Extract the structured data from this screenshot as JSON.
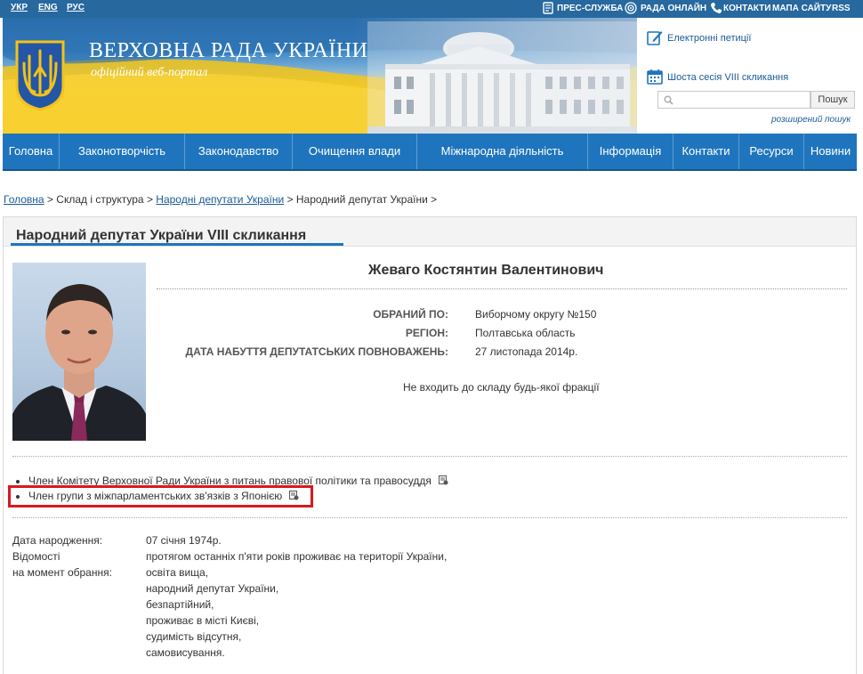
{
  "languages": [
    "УКР",
    "ENG",
    "РУС"
  ],
  "top_links": {
    "press": "ПРЕС-СЛУЖБА",
    "online": "РАДА ОНЛАЙН",
    "contacts": "КОНТАКТИ",
    "sitemap": "МАПА САЙТУ",
    "rss": "RSS"
  },
  "header": {
    "title": "ВЕРХОВНА РАДА УКРАЇНИ",
    "subtitle": "офіційний веб-портал",
    "petitions_link": "Електронні петиції",
    "session_link": "Шоста сесія VIII скликання",
    "search_button": "Пошук",
    "search_placeholder": "",
    "advanced_search": "розширений пошук"
  },
  "nav": [
    "Головна",
    "Законотворчість",
    "Законодавство",
    "Очищення влади",
    "Міжнародна діяльність",
    "Інформація",
    "Контакти",
    "Ресурси",
    "Новини"
  ],
  "breadcrumb": {
    "home": "Головна",
    "sep1": " > ",
    "structure": "Склад і структура",
    "sep2": " > ",
    "deputies": "Народні депутати України",
    "sep3": " > ",
    "current": "Народний депутат України",
    "sep4": " >"
  },
  "content": {
    "title": "Народний депутат України VIII скликання",
    "name": "Жеваго Костянтин Валентинович",
    "fields": [
      {
        "label": "ОБРАНИЙ ПО:",
        "value": "Виборчому округу №150"
      },
      {
        "label": "РЕГІОН:",
        "value": "Полтавська область"
      },
      {
        "label": "ДАТА НАБУТТЯ ДЕПУТАТСЬКИХ ПОВНОВАЖЕНЬ:",
        "value": "27 листопада 2014р."
      }
    ],
    "faction": "Не входить до складу будь-якої фракції",
    "memberships": [
      "Член Комітету Верховної Ради України з питань правової політики та правосуддя",
      "Член групи з міжпарламентських зв'язків з Японією"
    ],
    "bio": {
      "birth_label": "Дата народження:",
      "birth_value": "07 січня 1974р.",
      "info_label_1": "Відомості",
      "info_label_2": "на момент обрання:",
      "info_lines": [
        "протягом останніх п'яти років проживає на території України,",
        "освіта вища,",
        "народний депутат України,",
        "безпартійний,",
        "проживає в місті Києві,",
        "судимість відсутня,",
        "самовисування."
      ]
    }
  },
  "colors": {
    "top_bar": "#27689f",
    "nav": "#1f75bd",
    "link": "#1a5a96",
    "highlight": "#d71920"
  },
  "icons": [
    "press-icon",
    "online-icon",
    "phone-icon",
    "petitions-icon",
    "calendar-icon",
    "search-icon",
    "document-icon",
    "coat-of-arms-icon"
  ]
}
